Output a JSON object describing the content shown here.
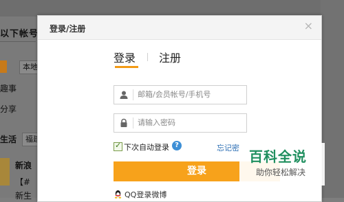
{
  "background": {
    "heading": "以下帐号为",
    "box1": "本地",
    "link1": "趣事",
    "link2": "分享",
    "row_label": "生活",
    "row_box": "福建",
    "news_title": "新浪",
    "news_line1": "【#",
    "news_line2": "新生"
  },
  "modal": {
    "title": "登录/注册",
    "close_symbol": "×",
    "tabs": [
      {
        "label": "登录",
        "active": true
      },
      {
        "label": "注册",
        "active": false
      }
    ],
    "account_placeholder": "邮箱/会员帐号/手机号",
    "password_placeholder": "请输入密码",
    "remember_label": "下次自动登录",
    "remember_checked": true,
    "help_symbol": "?",
    "forgot_label": "忘记密",
    "login_button": "登录",
    "qq_login_label": "QQ登录微博"
  },
  "watermark": {
    "title": "百科全说",
    "subtitle": "助你轻松解决"
  },
  "colors": {
    "accent": "#f7a21b",
    "link": "#2d6fb5",
    "watermark_green": "#1f8f5f"
  }
}
